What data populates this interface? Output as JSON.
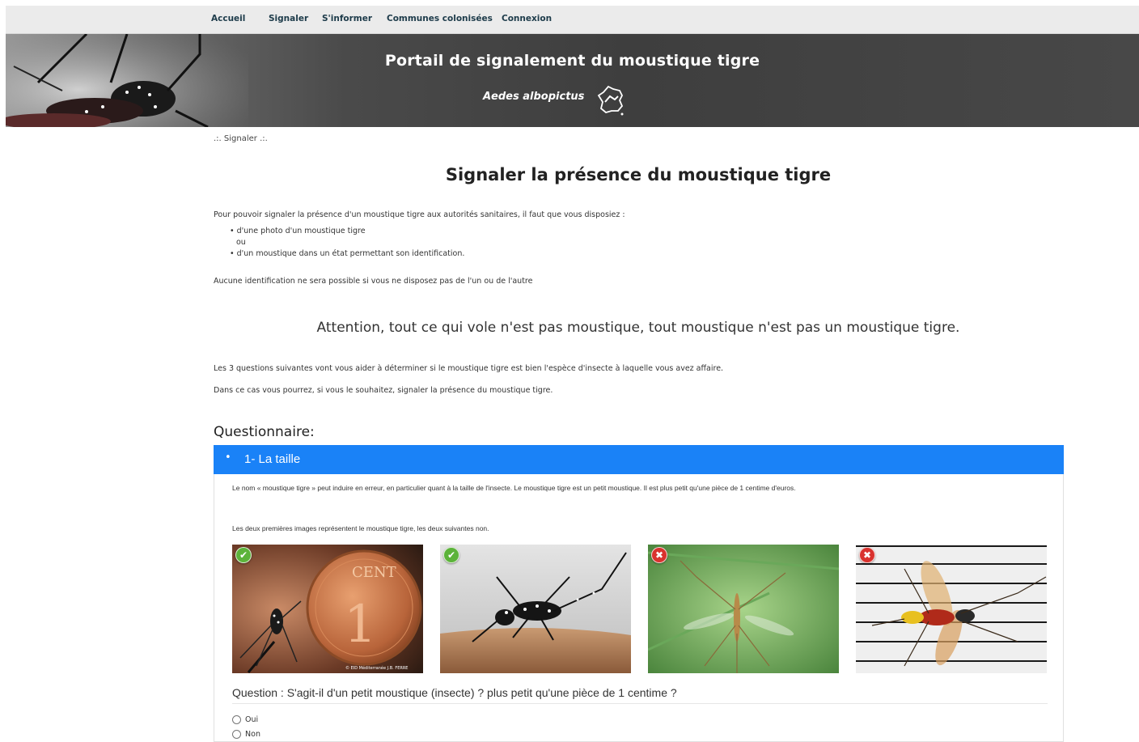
{
  "nav": {
    "items": [
      "Accueil",
      "Signaler",
      "S'informer",
      "Communes colonisées",
      "Connexion"
    ]
  },
  "header": {
    "title": "Portail de signalement du moustique tigre",
    "subtitle": "Aedes albopictus"
  },
  "breadcrumb": ".:. Signaler .:.",
  "main": {
    "title": "Signaler la présence du moustique tigre",
    "intro": "Pour pouvoir signaler la présence d'un moustique tigre aux autorités sanitaires, il faut que vous disposiez :",
    "bullet1": "• d'une photo d'un moustique tigre",
    "or": "ou",
    "bullet2": "• d'un moustique dans un état permettant son identification.",
    "no_id": "Aucune identification ne sera possible si vous ne disposez pas de l'un ou de l'autre",
    "attention": "Attention, tout ce qui vole n'est pas moustique, tout moustique n'est pas un moustique tigre.",
    "help1": "Les 3 questions suivantes vont vous aider à déterminer si le moustique tigre est bien l'espèce d'insecte à laquelle vous avez affaire.",
    "help2": "Dans ce cas vous pourrez, si vous le souhaitez, signaler la présence du moustique tigre."
  },
  "questionnaire": {
    "label": "Questionnaire:",
    "section": {
      "bullet": "•",
      "title": "1- La taille",
      "text1": "Le nom « moustique tigre » peut induire en erreur, en particulier quant à la taille de l'insecte. Le moustique tigre est un petit moustique. Il est plus petit qu'une pièce de 1 centime d'euros.",
      "text2": "Les deux premières images représentent le moustique tigre, les deux suivantes non.",
      "images": [
        {
          "badge": "✔",
          "status": "correct",
          "caption": "CENT",
          "digit": "1",
          "credit": "© EID Méditerranée J.B. FERRE"
        },
        {
          "badge": "✔",
          "status": "correct"
        },
        {
          "badge": "✖",
          "status": "incorrect"
        },
        {
          "badge": "✖",
          "status": "incorrect"
        }
      ],
      "question": "Question : S'agit-il d'un petit moustique (insecte) ? plus petit qu'une pièce de 1 centime ?",
      "options": [
        "Oui",
        "Non"
      ]
    }
  },
  "colors": {
    "accent": "#1a82f7",
    "nav_bg": "#ebebeb",
    "banner_bg": "#3e3e3e",
    "ok": "#5cb33a",
    "no": "#d9322e"
  }
}
